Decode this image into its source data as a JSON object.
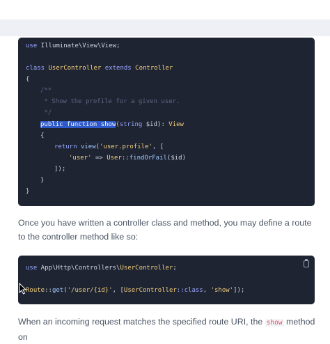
{
  "code1": {
    "use_kw": "use",
    "use_path": " Illuminate\\View\\View;",
    "class_kw": "class",
    "class_name": "UserController",
    "extends_kw": "extends",
    "parent_class": "Controller",
    "open_brace": "{",
    "doc_open": "/**",
    "doc_text": " * Show the profile for a given user.",
    "doc_close": " */",
    "sel_public": "public",
    "sel_function": "function",
    "sel_name": "show",
    "sig_rest_open": "(",
    "sig_type": "string",
    "sig_var": " $id",
    "sig_close": "):",
    "return_type": "View",
    "method_open": "{",
    "return_kw": "return",
    "view_fn": "view",
    "view_arg": "'user.profile'",
    "view_rest": ", [",
    "arr_key": "'user'",
    "arr_arrow": " => ",
    "arr_class": "User",
    "arr_sep": "::",
    "arr_fn": "findOrFail",
    "arr_arg": "($id)",
    "arr_close": "]);",
    "method_close": "}",
    "class_close": "}"
  },
  "para1": {
    "text": "Once you have written a controller class and method, you may define a route to the controller method like so:"
  },
  "code2": {
    "use_kw": "use",
    "use_path": " App\\Http\\Controllers\\",
    "use_class": "UserController",
    "use_end": ";",
    "route_cls": "Route",
    "route_sep": "::",
    "route_fn": "get",
    "route_open": "(",
    "route_uri": "'/user/{id}'",
    "route_mid": ", [",
    "route_ctrl": "UserController",
    "route_class_kw": "::class",
    "route_comma": ", ",
    "route_method": "'show'",
    "route_end": "]);"
  },
  "para2": {
    "text_before": "When an incoming request matches the specified route URI, the ",
    "code": "show",
    "text_after": " method on"
  }
}
